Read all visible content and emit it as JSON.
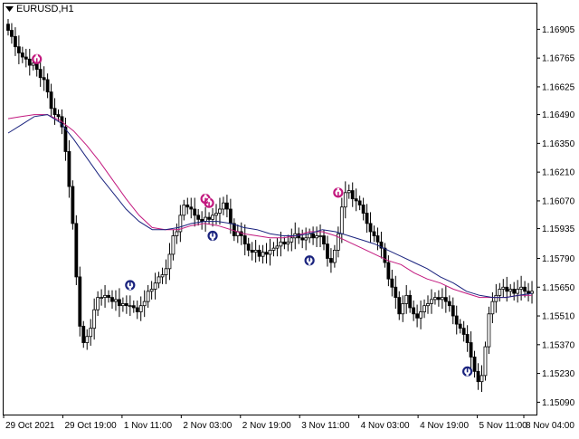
{
  "window": {
    "symbol_label": "EURUSD,H1",
    "dropdown_icon": "triangle-down-icon"
  },
  "colors": {
    "background": "#ffffff",
    "bull_candle": "#ffffff",
    "bear_candle": "#000000",
    "candle_outline": "#000000",
    "ma_fast": "#c2187e",
    "ma_slow": "#1a237e",
    "arrow_sell": "#c2187e",
    "arrow_buy": "#1a237e",
    "axis": "#000000"
  },
  "chart_data": {
    "type": "candlestick",
    "symbol": "EURUSD",
    "timeframe": "H1",
    "y_ticks": [
      "1.16905",
      "1.16765",
      "1.16625",
      "1.16490",
      "1.16350",
      "1.16210",
      "1.16070",
      "1.15935",
      "1.15790",
      "1.15650",
      "1.15510",
      "1.15370",
      "1.15230",
      "1.15090"
    ],
    "x_ticks": [
      "29 Oct 2021",
      "29 Oct 19:00",
      "1 Nov 11:00",
      "2 Nov 03:00",
      "2 Nov 19:00",
      "3 Nov 11:00",
      "4 Nov 03:00",
      "4 Nov 19:00",
      "5 Nov 11:00",
      "8 Nov 04:00"
    ],
    "ylim": [
      1.1503,
      1.1703
    ],
    "closes": [
      1.169,
      1.1687,
      1.1682,
      1.1679,
      1.1677,
      1.1676,
      1.1673,
      1.1674,
      1.1671,
      1.1667,
      1.1666,
      1.166,
      1.1652,
      1.1649,
      1.1648,
      1.1643,
      1.1631,
      1.1614,
      1.1596,
      1.157,
      1.1546,
      1.1538,
      1.1541,
      1.1545,
      1.1554,
      1.156,
      1.156,
      1.1561,
      1.156,
      1.1558,
      1.1559,
      1.1556,
      1.1557,
      1.1556,
      1.1556,
      1.1555,
      1.1553,
      1.1556,
      1.1558,
      1.1563,
      1.1564,
      1.1567,
      1.157,
      1.1571,
      1.1574,
      1.1581,
      1.159,
      1.1592,
      1.16,
      1.1605,
      1.1604,
      1.1603,
      1.16,
      1.1598,
      1.1597,
      1.1599,
      1.1598,
      1.16,
      1.1601,
      1.1603,
      1.1606,
      1.1603,
      1.1596,
      1.159,
      1.1592,
      1.159,
      1.1586,
      1.1583,
      1.1582,
      1.1583,
      1.158,
      1.1582,
      1.1581,
      1.1583,
      1.1584,
      1.1585,
      1.1587,
      1.1586,
      1.1587,
      1.1589,
      1.1591,
      1.1589,
      1.1588,
      1.1589,
      1.1591,
      1.1589,
      1.159,
      1.159,
      1.1586,
      1.1579,
      1.1577,
      1.1583,
      1.1591,
      1.1604,
      1.1611,
      1.1612,
      1.1608,
      1.1607,
      1.1605,
      1.1601,
      1.1596,
      1.1592,
      1.159,
      1.1587,
      1.1584,
      1.1577,
      1.1569,
      1.1565,
      1.156,
      1.1552,
      1.1557,
      1.1561,
      1.1555,
      1.1552,
      1.155,
      1.1553,
      1.1556,
      1.1557,
      1.1559,
      1.156,
      1.1559,
      1.156,
      1.1558,
      1.1556,
      1.1551,
      1.1547,
      1.1545,
      1.1542,
      1.1538,
      1.1531,
      1.1524,
      1.1519,
      1.1522,
      1.1536,
      1.1552,
      1.1558,
      1.1561,
      1.1564,
      1.1565,
      1.1563,
      1.1564,
      1.1562,
      1.1564,
      1.1565,
      1.1563,
      1.1562,
      1.1563
    ],
    "ma_fast": [
      1.1647,
      1.1648,
      1.1649,
      1.1649,
      1.1646,
      1.1641,
      1.1634,
      1.1626,
      1.1617,
      1.1608,
      1.16,
      1.1594,
      1.1593,
      1.1593,
      1.1595,
      1.1596,
      1.1595,
      1.1593,
      1.1591,
      1.159,
      1.1589,
      1.1589,
      1.159,
      1.1592,
      1.1592,
      1.159,
      1.1587,
      1.1584,
      1.1581,
      1.1578,
      1.1576,
      1.1572,
      1.1569,
      1.1567,
      1.1564,
      1.1562,
      1.156,
      1.156,
      1.156,
      1.1561,
      1.1561
    ],
    "ma_slow": [
      1.164,
      1.1644,
      1.1648,
      1.1649,
      1.1645,
      1.1637,
      1.1628,
      1.1619,
      1.1611,
      1.1603,
      1.1597,
      1.1593,
      1.1593,
      1.1594,
      1.1596,
      1.1597,
      1.1597,
      1.1596,
      1.1594,
      1.1593,
      1.1591,
      1.159,
      1.159,
      1.1591,
      1.1593,
      1.1592,
      1.159,
      1.1588,
      1.1586,
      1.1583,
      1.158,
      1.1577,
      1.1574,
      1.157,
      1.1567,
      1.1563,
      1.1561,
      1.156,
      1.156,
      1.1561,
      1.1562
    ],
    "signals": [
      {
        "type": "sell",
        "index": 8,
        "price": 1.1676
      },
      {
        "type": "buy",
        "index": 34,
        "price": 1.1566
      },
      {
        "type": "sell",
        "index": 55,
        "price": 1.1608
      },
      {
        "type": "sell",
        "index": 56,
        "price": 1.1606
      },
      {
        "type": "buy",
        "index": 57,
        "price": 1.159
      },
      {
        "type": "buy",
        "index": 84,
        "price": 1.1578
      },
      {
        "type": "sell",
        "index": 92,
        "price": 1.1611
      },
      {
        "type": "buy",
        "index": 128,
        "price": 1.1524
      }
    ],
    "grid": false,
    "legend": "none"
  }
}
